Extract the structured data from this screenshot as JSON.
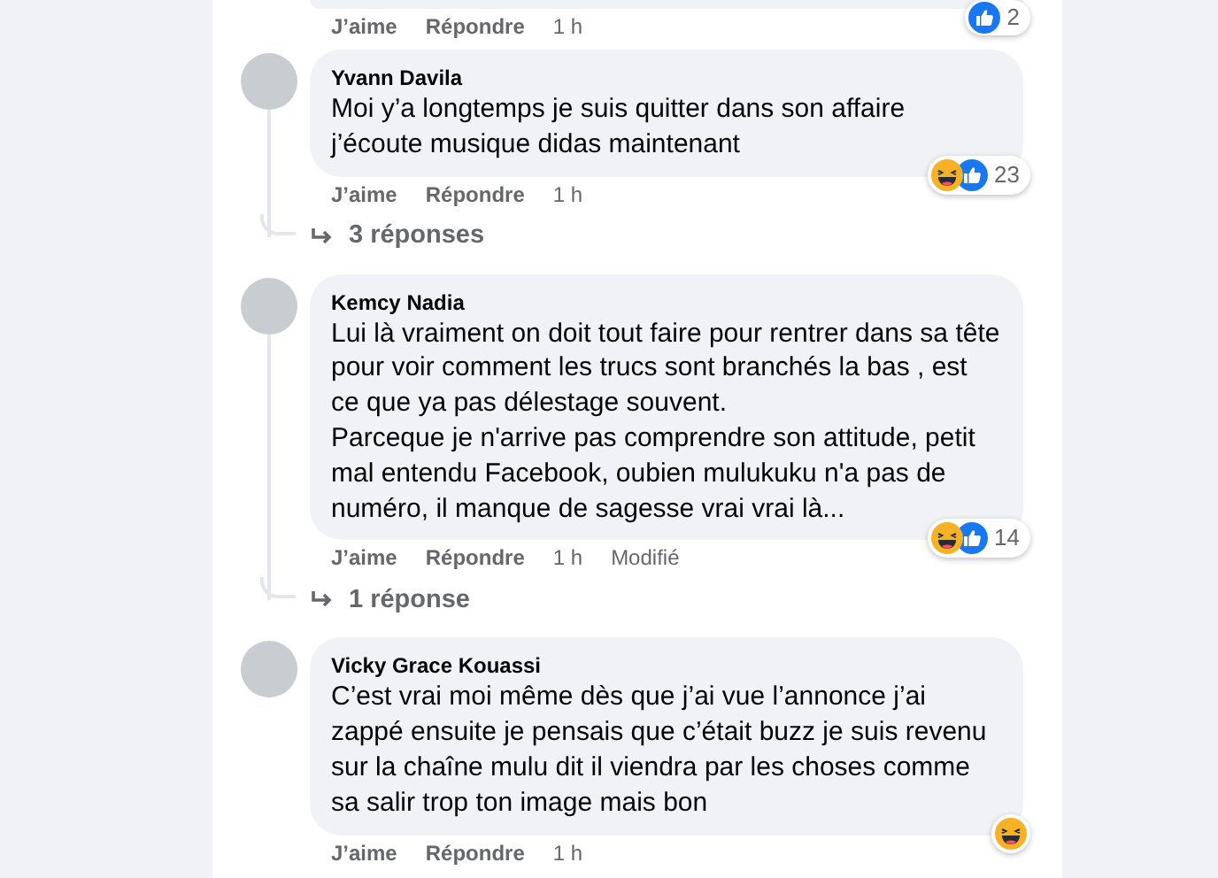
{
  "top_comment": {
    "actions": [
      {
        "label": "J’aime"
      },
      {
        "label": "Répondre"
      },
      {
        "label": "1 h"
      }
    ],
    "reactions": [
      {
        "kind": "like"
      }
    ],
    "reaction_count": "2"
  },
  "comments": [
    {
      "name": "Yvann Davila",
      "text": "Moi y’a longtemps je suis quitter dans son affaire j’écoute musique didas maintenant",
      "actions": [
        {
          "label": "J’aime"
        },
        {
          "label": "Répondre"
        },
        {
          "label": "1 h"
        }
      ],
      "reactions": [
        {
          "kind": "haha"
        },
        {
          "kind": "like"
        }
      ],
      "reaction_count": "23",
      "replies": "3 réponses"
    },
    {
      "name": "Kemcy Nadia",
      "text": "Lui là vraiment on doit tout faire pour rentrer dans sa tête pour voir comment les trucs sont branchés la bas , est ce que ya pas délestage souvent.\nParceque je n'arrive pas comprendre son attitude, petit mal entendu Facebook, oubien mulukuku n'a pas de numéro, il manque de sagesse vrai vrai là...",
      "actions": [
        {
          "label": "J’aime"
        },
        {
          "label": "Répondre"
        },
        {
          "label": "1 h"
        },
        {
          "label": "Modifié"
        }
      ],
      "reactions": [
        {
          "kind": "haha"
        },
        {
          "kind": "like"
        }
      ],
      "reaction_count": "14",
      "replies": "1 réponse"
    },
    {
      "name": "Vicky Grace Kouassi",
      "text": "C’est vrai moi même dès que j’ai vue l’annonce j’ai zappé ensuite je pensais que c’était buzz je suis revenu sur la chaîne mulu dit il viendra par les choses comme sa salir trop ton image mais bon",
      "actions": [
        {
          "label": "J’aime"
        },
        {
          "label": "Répondre"
        },
        {
          "label": "1 h"
        }
      ],
      "reactions": [
        {
          "kind": "haha"
        }
      ]
    }
  ]
}
